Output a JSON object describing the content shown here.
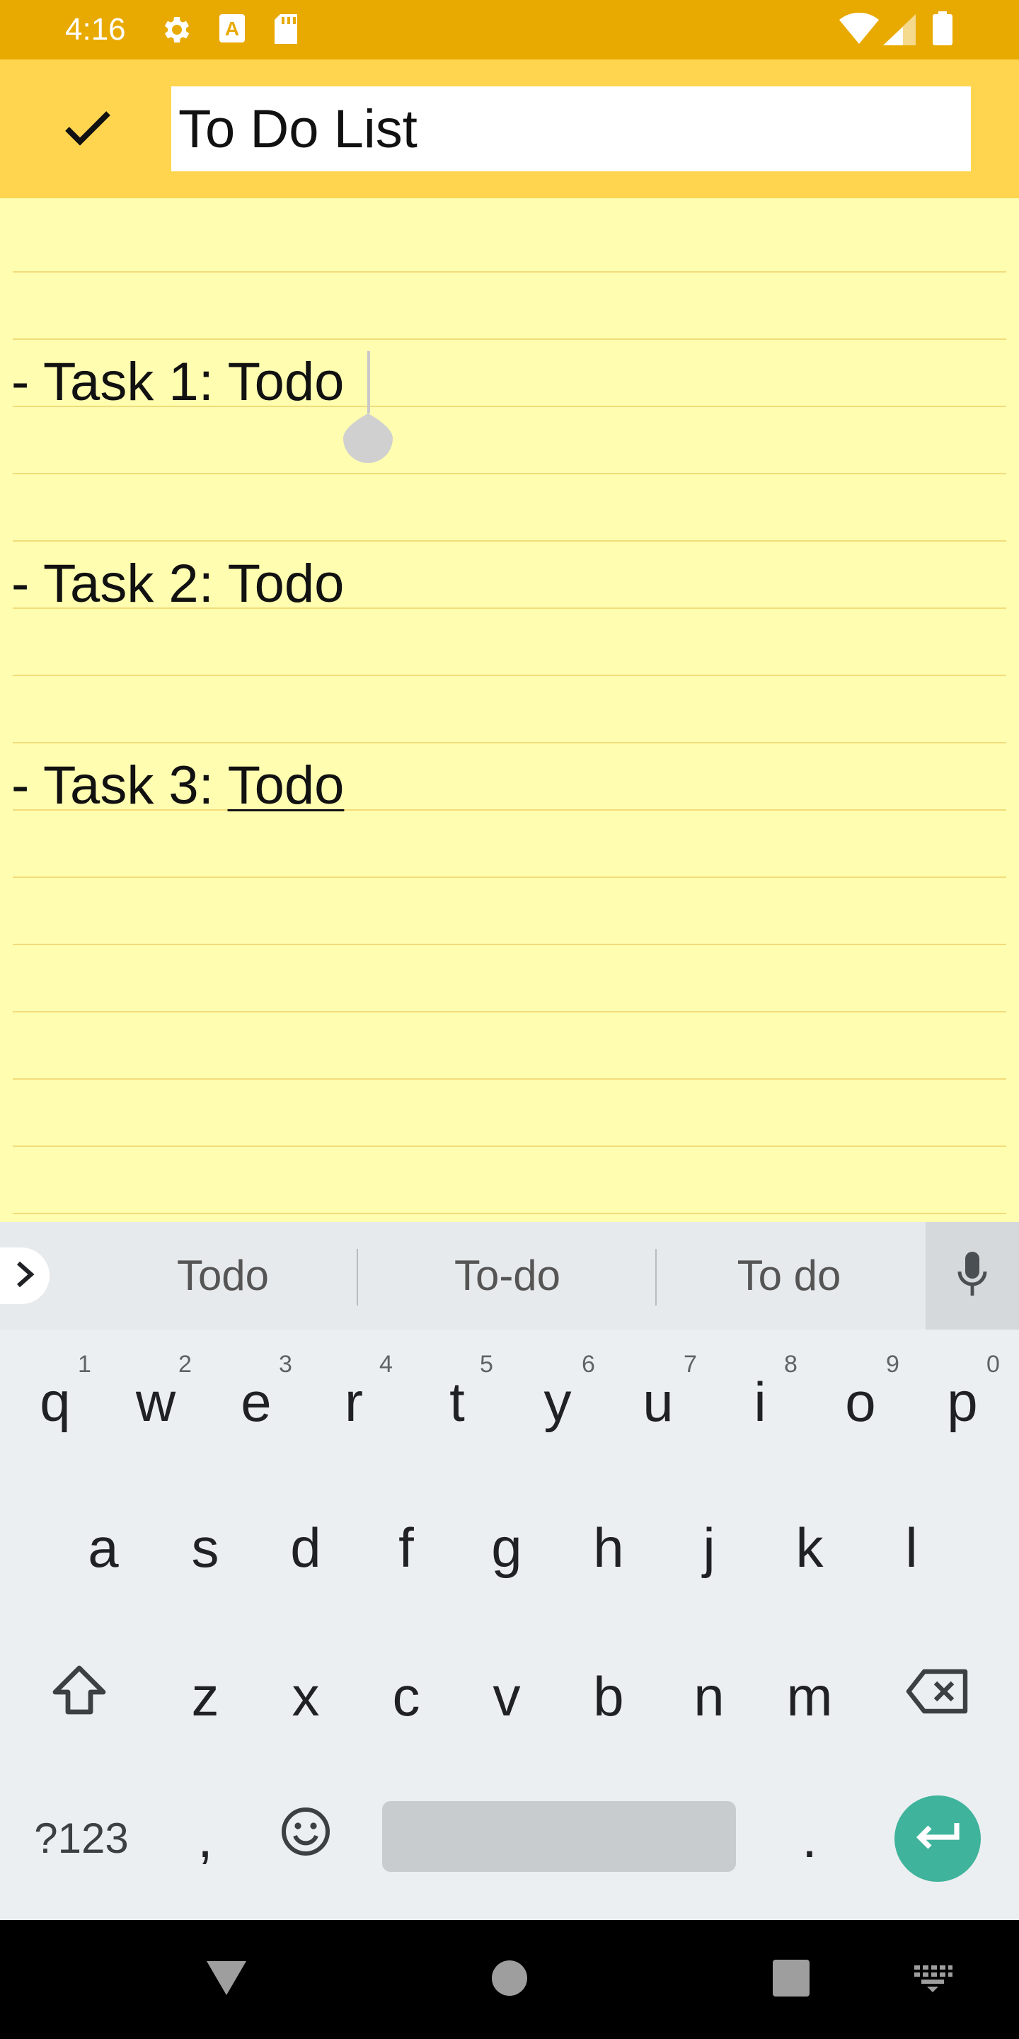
{
  "status_bar": {
    "time": "4:16",
    "icons": [
      "gear-icon",
      "text-a-icon",
      "sd-card-icon",
      "wifi-icon",
      "signal-icon",
      "battery-icon"
    ],
    "background": "#e8aa00"
  },
  "toolbar": {
    "background": "#ffd54f",
    "title_value": "To Do List",
    "confirm_icon": "check-icon"
  },
  "note": {
    "background": "#fffdb0",
    "lines": [
      {
        "prefix": "- Task 1: ",
        "word": "Todo"
      },
      {
        "prefix": "- Task 2: ",
        "word": "Todo"
      },
      {
        "prefix": "- Task 3: ",
        "word": "Todo"
      }
    ]
  },
  "keyboard": {
    "suggestions": [
      "Todo",
      "To-do",
      "To do"
    ],
    "row1": [
      {
        "key": "q",
        "hint": "1"
      },
      {
        "key": "w",
        "hint": "2"
      },
      {
        "key": "e",
        "hint": "3"
      },
      {
        "key": "r",
        "hint": "4"
      },
      {
        "key": "t",
        "hint": "5"
      },
      {
        "key": "y",
        "hint": "6"
      },
      {
        "key": "u",
        "hint": "7"
      },
      {
        "key": "i",
        "hint": "8"
      },
      {
        "key": "o",
        "hint": "9"
      },
      {
        "key": "p",
        "hint": "0"
      }
    ],
    "row2": [
      "a",
      "s",
      "d",
      "f",
      "g",
      "h",
      "j",
      "k",
      "l"
    ],
    "row3": [
      "z",
      "x",
      "c",
      "v",
      "b",
      "n",
      "m"
    ],
    "symbols_label": "?123",
    "comma": ",",
    "period": ".",
    "enter_color": "#3fb39c"
  },
  "nav_bar": {
    "icons": [
      "back-icon",
      "home-icon",
      "recents-icon",
      "keyboard-switch-icon"
    ]
  }
}
